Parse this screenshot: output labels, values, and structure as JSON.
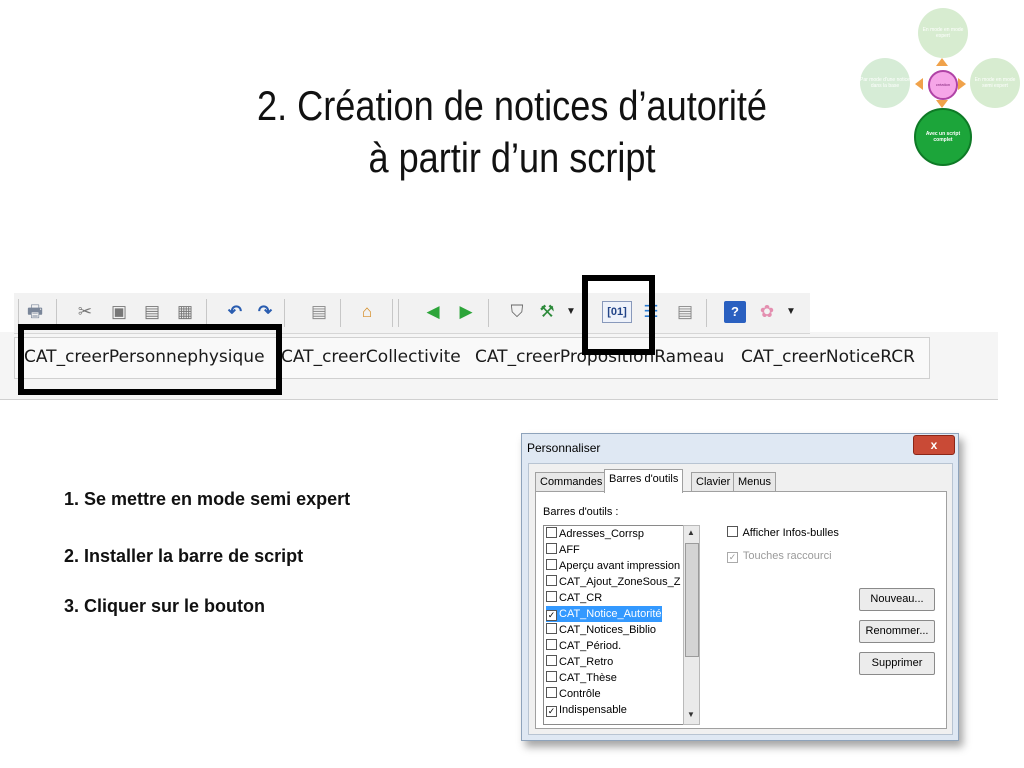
{
  "slide": {
    "title_line1": "2. Création de notices d’autorité",
    "title_line2": "à partir d’un script",
    "instructions": [
      "1. Se mettre en mode semi expert",
      "2. Installer la barre de script",
      "3. Cliquer sur le bouton"
    ]
  },
  "cycle_diagram": {
    "top": "En mode en mode expert",
    "left": "Par mode d'une notice dans la base",
    "right": "En mode en mode semi expert",
    "bottom": "Avec un script complet",
    "center": "création",
    "colors": {
      "light": "#d7ecd0",
      "active": "#1ca53a",
      "center": "#f6a6e8",
      "arrow": "#f0a24a"
    }
  },
  "toolbar": {
    "icons": [
      "printer-icon",
      "cut-icon",
      "copy-icon",
      "paste-icon",
      "paste-special-icon",
      "undo-icon",
      "redo-icon",
      "save-icon",
      "home-icon",
      "back-icon",
      "forward-icon",
      "filter-icon",
      "tools-icon",
      "dropdown-icon",
      "field-icon",
      "list-icon",
      "notepad-icon",
      "help-icon",
      "pig-icon",
      "dropdown-icon"
    ],
    "highlighted_button": "[01]"
  },
  "script_toolbar": {
    "buttons": [
      "CAT_creerPersonnephysique",
      "CAT_creerCollectivite",
      "CAT_creerPropositionRameau",
      "CAT_creerNoticeRCR"
    ]
  },
  "dialog": {
    "title": "Personnaliser",
    "close": "x",
    "tabs": [
      "Commandes",
      "Barres d'outils",
      "Clavier",
      "Menus"
    ],
    "active_tab": "Barres d'outils",
    "toolbars_label": "Barres d'outils :",
    "toolbars": [
      {
        "label": "Adresses_Corrsp",
        "checked": false
      },
      {
        "label": "AFF",
        "checked": false
      },
      {
        "label": "Aperçu avant impression",
        "checked": false
      },
      {
        "label": "CAT_Ajout_ZoneSous_Z",
        "checked": false
      },
      {
        "label": "CAT_CR",
        "checked": false
      },
      {
        "label": "CAT_Notice_Autorité",
        "checked": true,
        "selected": true
      },
      {
        "label": "CAT_Notices_Biblio",
        "checked": false
      },
      {
        "label": "CAT_Périod.",
        "checked": false
      },
      {
        "label": "CAT_Retro",
        "checked": false
      },
      {
        "label": "CAT_Thèse",
        "checked": false
      },
      {
        "label": "Contrôle",
        "checked": false
      },
      {
        "label": "Indispensable",
        "checked": true
      }
    ],
    "options": [
      {
        "label": "Afficher Infos-bulles",
        "checked": false,
        "enabled": true
      },
      {
        "label": "Touches raccourci",
        "checked": true,
        "enabled": false
      }
    ],
    "buttons": [
      "Nouveau...",
      "Renommer...",
      "Supprimer"
    ]
  }
}
